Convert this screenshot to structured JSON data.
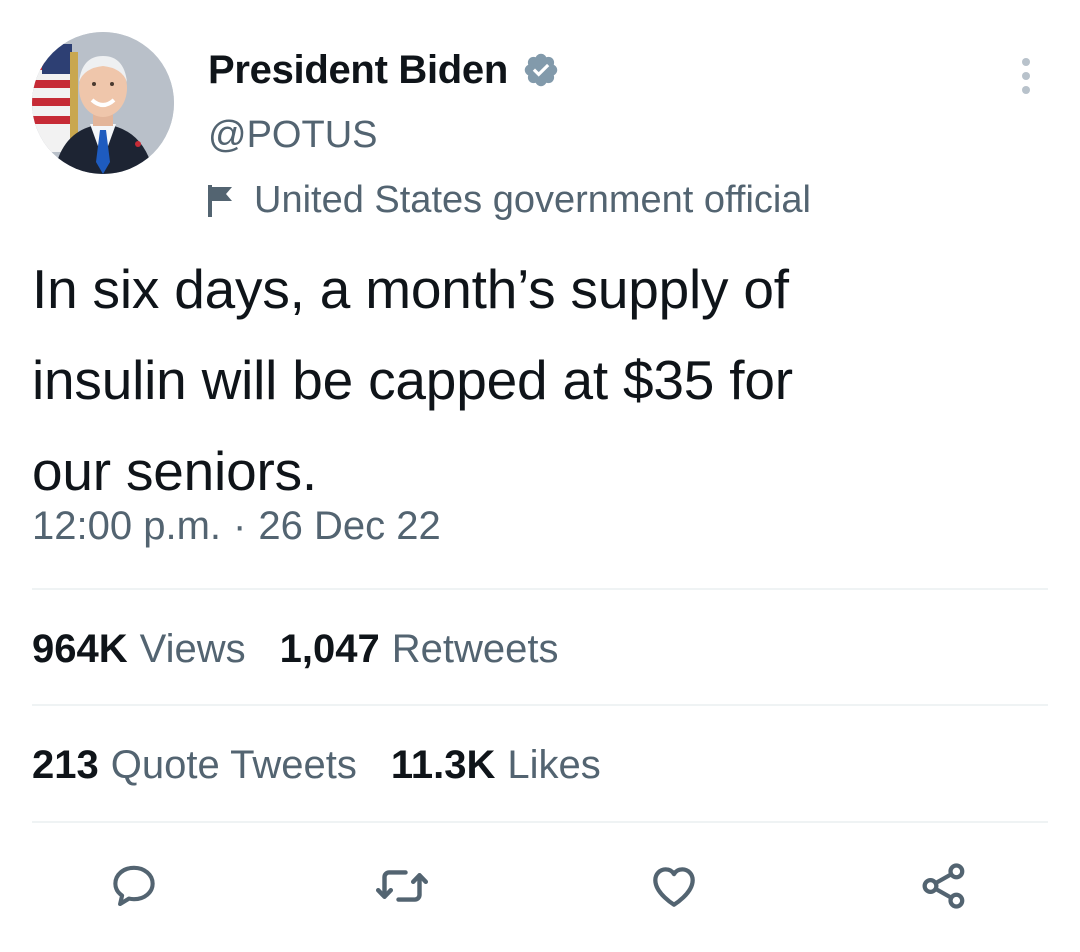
{
  "author": {
    "display_name": "President Biden",
    "handle": "@POTUS",
    "verified": true,
    "label": "United States government official",
    "avatar": "portrait-photo"
  },
  "tweet": {
    "text": "In six days, a month’s supply of\ninsulin will be capped at $35 for\nour seniors.",
    "time": "12:00 p.m.",
    "separator": "·",
    "date": "26 Dec 22"
  },
  "stats": {
    "views_count": "964K",
    "views_label": "Views",
    "retweets_count": "1,047",
    "retweets_label": "Retweets",
    "quotes_count": "213",
    "quotes_label": "Quote Tweets",
    "likes_count": "11.3K",
    "likes_label": "Likes"
  },
  "actions": [
    {
      "name": "reply",
      "icon": "speech-bubble-icon"
    },
    {
      "name": "retweet",
      "icon": "retweet-arrows-icon"
    },
    {
      "name": "like",
      "icon": "heart-icon"
    },
    {
      "name": "share",
      "icon": "share-nodes-icon"
    }
  ],
  "colors": {
    "text_primary": "#0f1419",
    "text_secondary": "#536471",
    "verified_badge": "#829aab",
    "divider": "#eff3f4"
  }
}
